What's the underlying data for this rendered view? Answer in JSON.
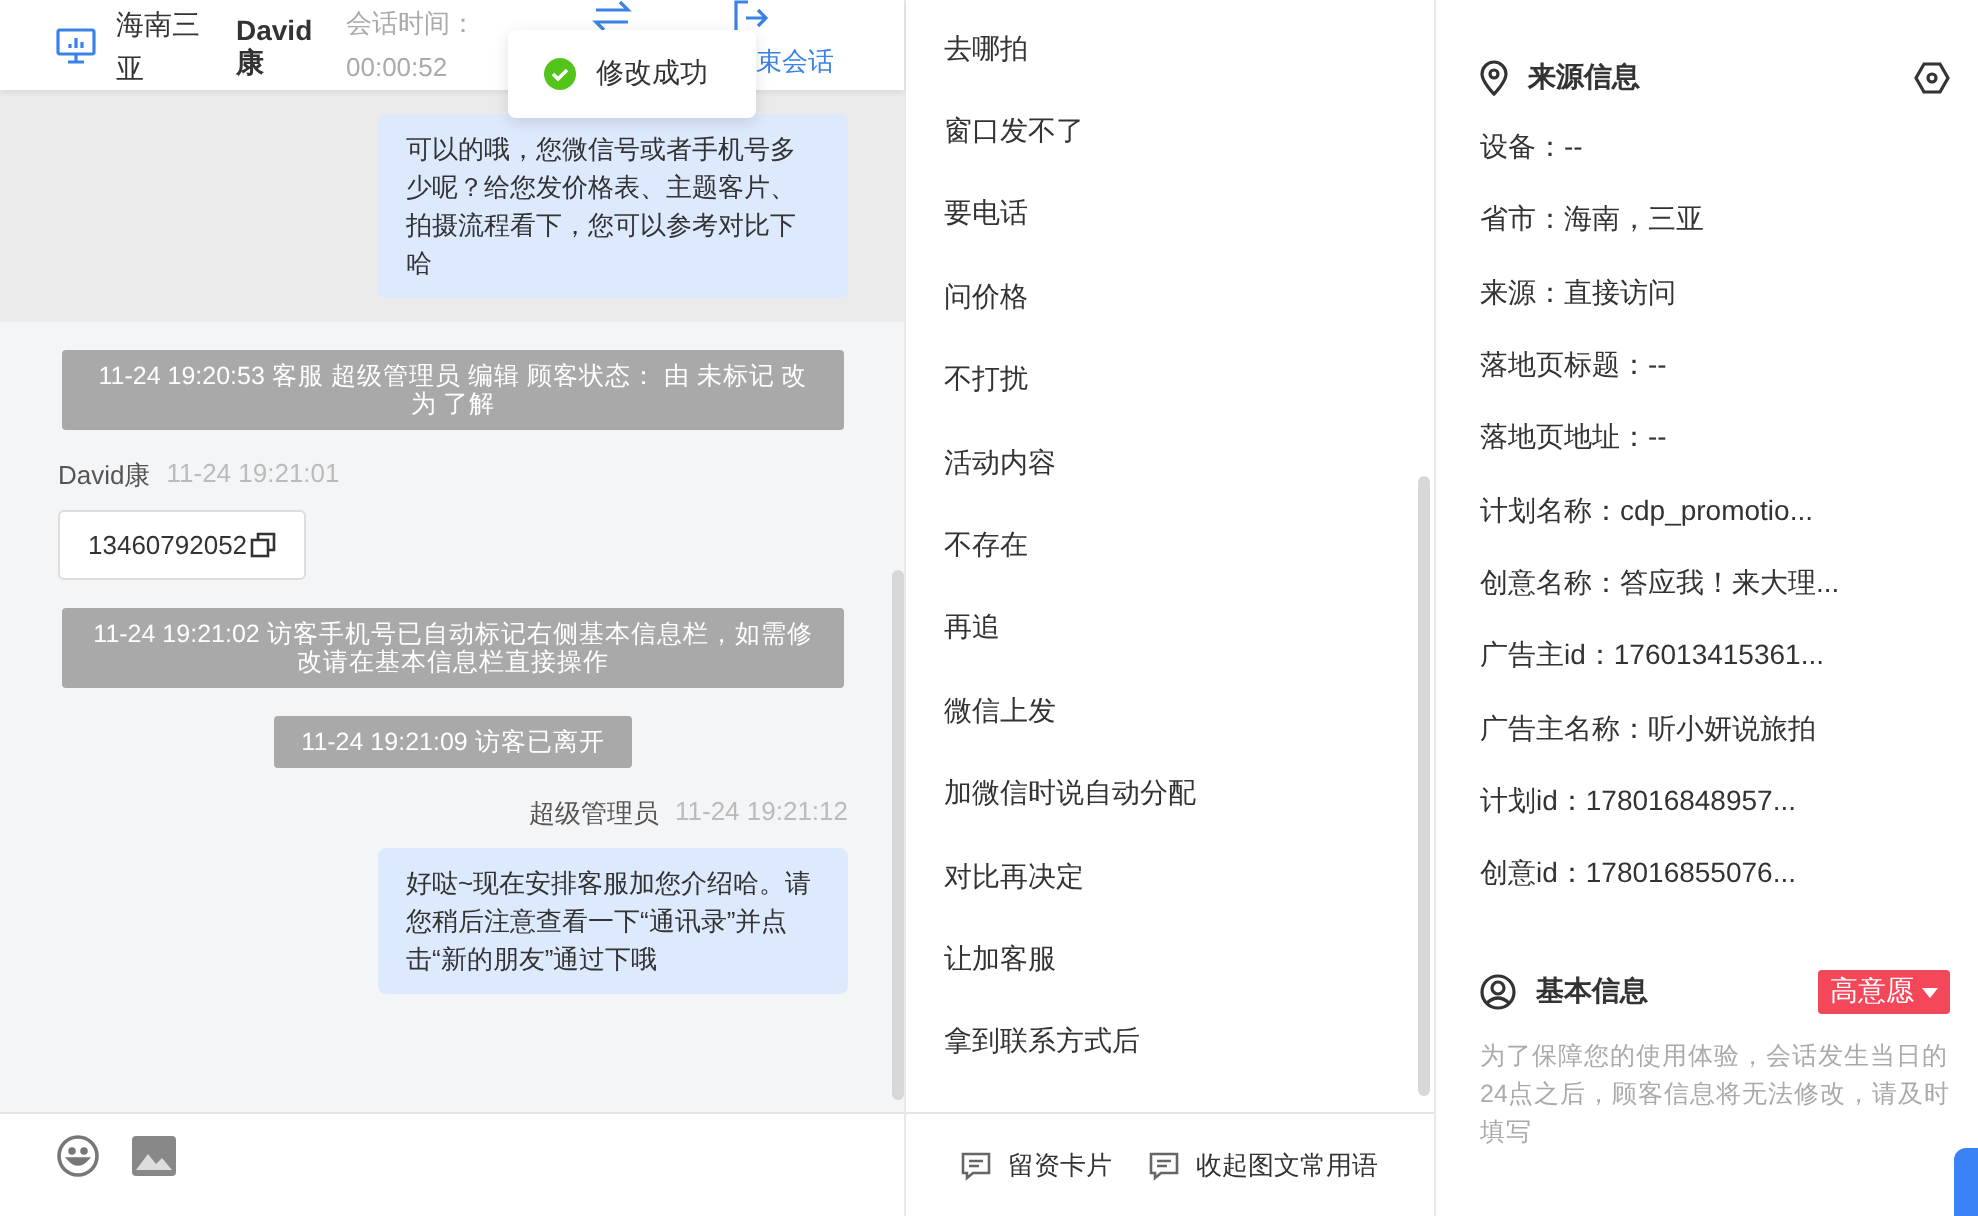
{
  "header": {
    "location": "海南三亚",
    "visitor": "David康",
    "session_label": "会话时间：",
    "session_time": "00:00:52",
    "end_link": "束会话"
  },
  "toast": {
    "text": "修改成功"
  },
  "messages": [
    {
      "kind": "agent",
      "highlighted": true,
      "text": "可以的哦，您微信号或者手机号多少呢？给您发价格表、主题客片、拍摄流程看下，您可以参考对比下哈"
    },
    {
      "kind": "notice",
      "text": "11-24 19:20:53 客服 超级管理员 编辑 顾客状态： 由 未标记 改为 了解"
    },
    {
      "kind": "visitor",
      "sender": "David康",
      "time": "11-24 19:21:01",
      "text": "13460792052"
    },
    {
      "kind": "notice",
      "text": "11-24 19:21:02 访客手机号已自动标记右侧基本信息栏，如需修改请在基本信息栏直接操作"
    },
    {
      "kind": "short_notice",
      "text": "11-24 19:21:09 访客已离开"
    },
    {
      "kind": "agent",
      "highlighted": false,
      "sender": "超级管理员",
      "time": "11-24 19:21:12",
      "text": "好哒~现在安排客服加您介绍哈。请您稍后注意查看一下“通讯录”并点击“新的朋友”通过下哦"
    }
  ],
  "quick_replies": [
    "去哪拍",
    "窗口发不了",
    "要电话",
    "问价格",
    "不打扰",
    "活动内容",
    "不存在",
    "再追",
    "微信上发",
    "加微信时说自动分配",
    "对比再决定",
    "让加客服",
    "拿到联系方式后"
  ],
  "footer_actions": [
    "留资卡片",
    "收起图文常用语"
  ],
  "source_info": {
    "title": "来源信息",
    "fields": [
      "设备：--",
      "省市：海南，三亚",
      "来源：直接访问",
      "落地页标题：--",
      "落地页地址：--",
      "计划名称：cdp_promotio...",
      "创意名称：答应我！来大理...",
      "广告主id：176013415361...",
      "广告主名称：听小妍说旅拍",
      "计划id：178016848957...",
      "创意id：178016855076..."
    ]
  },
  "basic_info": {
    "title": "基本信息",
    "tag": "高意愿",
    "note": "为了保障您的使用体验，会话发生当日的24点之后，顾客信息将无法修改，请及时填写"
  }
}
